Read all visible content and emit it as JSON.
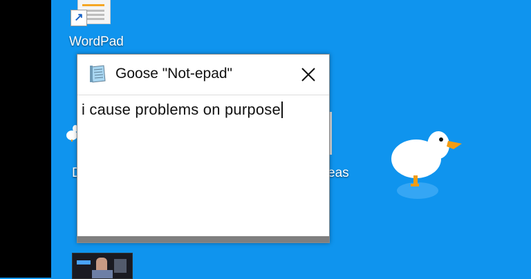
{
  "desktop": {
    "icons": [
      {
        "label": "WordPad"
      }
    ],
    "partial_labels": {
      "left": "D",
      "right": "eas"
    }
  },
  "window": {
    "title": "Goose \"Not-epad\"",
    "content": "i cause problems on purpose"
  },
  "colors": {
    "desktop_bg": "#0f94ee",
    "titlebar_bg": "#ffffff",
    "status_strip": "#7f7f7f"
  },
  "icons": {
    "app": "notepad-icon",
    "close": "close-icon",
    "shortcut": "shortcut-arrow-icon"
  }
}
